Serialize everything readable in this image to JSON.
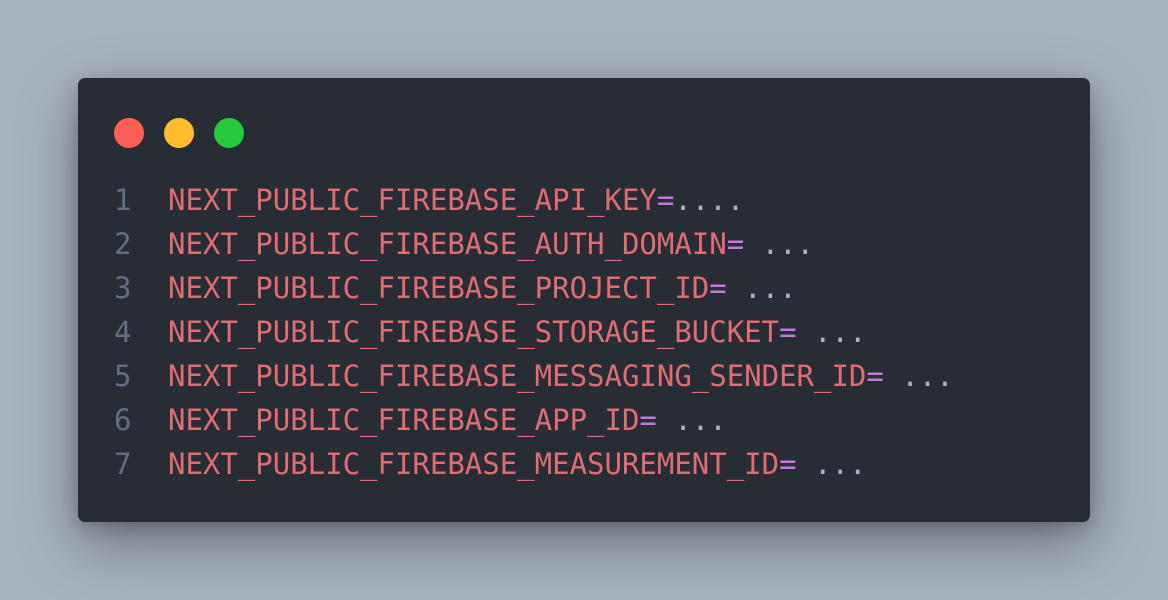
{
  "colors": {
    "background": "#a8b2bd",
    "window": "#282c34",
    "close": "#ff5f56",
    "minimize": "#ffbd2e",
    "maximize": "#27c93f",
    "line_number": "#636d83",
    "key": "#e06c75",
    "operator": "#c678dd",
    "value": "#abb2bf"
  },
  "window_buttons": [
    "close",
    "minimize",
    "maximize"
  ],
  "lines": [
    {
      "num": "1",
      "key": "NEXT_PUBLIC_FIREBASE_API_KEY",
      "eq": "=",
      "value": "...."
    },
    {
      "num": "2",
      "key": "NEXT_PUBLIC_FIREBASE_AUTH_DOMAIN",
      "eq": "=",
      "value": " ..."
    },
    {
      "num": "3",
      "key": "NEXT_PUBLIC_FIREBASE_PROJECT_ID",
      "eq": "=",
      "value": " ..."
    },
    {
      "num": "4",
      "key": "NEXT_PUBLIC_FIREBASE_STORAGE_BUCKET",
      "eq": "=",
      "value": " ..."
    },
    {
      "num": "5",
      "key": "NEXT_PUBLIC_FIREBASE_MESSAGING_SENDER_ID",
      "eq": "=",
      "value": " ..."
    },
    {
      "num": "6",
      "key": "NEXT_PUBLIC_FIREBASE_APP_ID",
      "eq": "=",
      "value": " ..."
    },
    {
      "num": "7",
      "key": "NEXT_PUBLIC_FIREBASE_MEASUREMENT_ID",
      "eq": "=",
      "value": " ..."
    }
  ]
}
